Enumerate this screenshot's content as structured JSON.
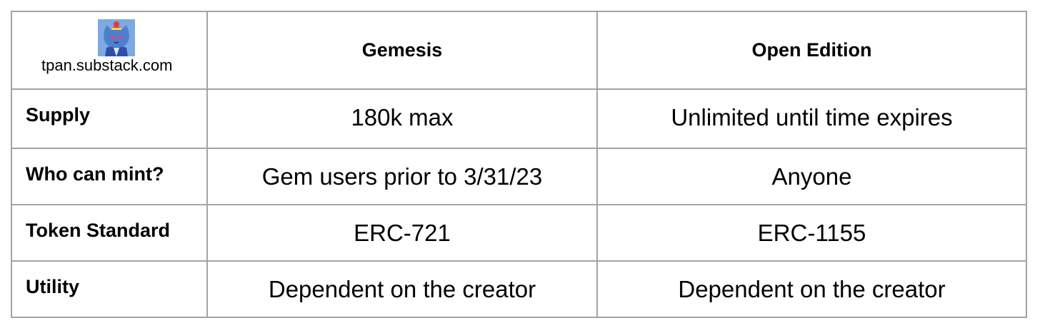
{
  "header": {
    "site": "tpan.substack.com",
    "avatar_icon": "cat-avatar-icon",
    "columns": [
      "Gemesis",
      "Open Edition"
    ]
  },
  "rows": [
    {
      "label": "Supply",
      "values": [
        "180k max",
        "Unlimited until time expires"
      ]
    },
    {
      "label": "Who can mint?",
      "values": [
        "Gem users prior to 3/31/23",
        "Anyone"
      ]
    },
    {
      "label": "Token Standard",
      "values": [
        "ERC-721",
        "ERC-1155"
      ]
    },
    {
      "label": "Utility",
      "values": [
        "Dependent on the creator",
        "Dependent on the creator"
      ]
    }
  ],
  "colors": {
    "border": "#a3a3a3",
    "avatar_bg": "#7ea9e1"
  }
}
